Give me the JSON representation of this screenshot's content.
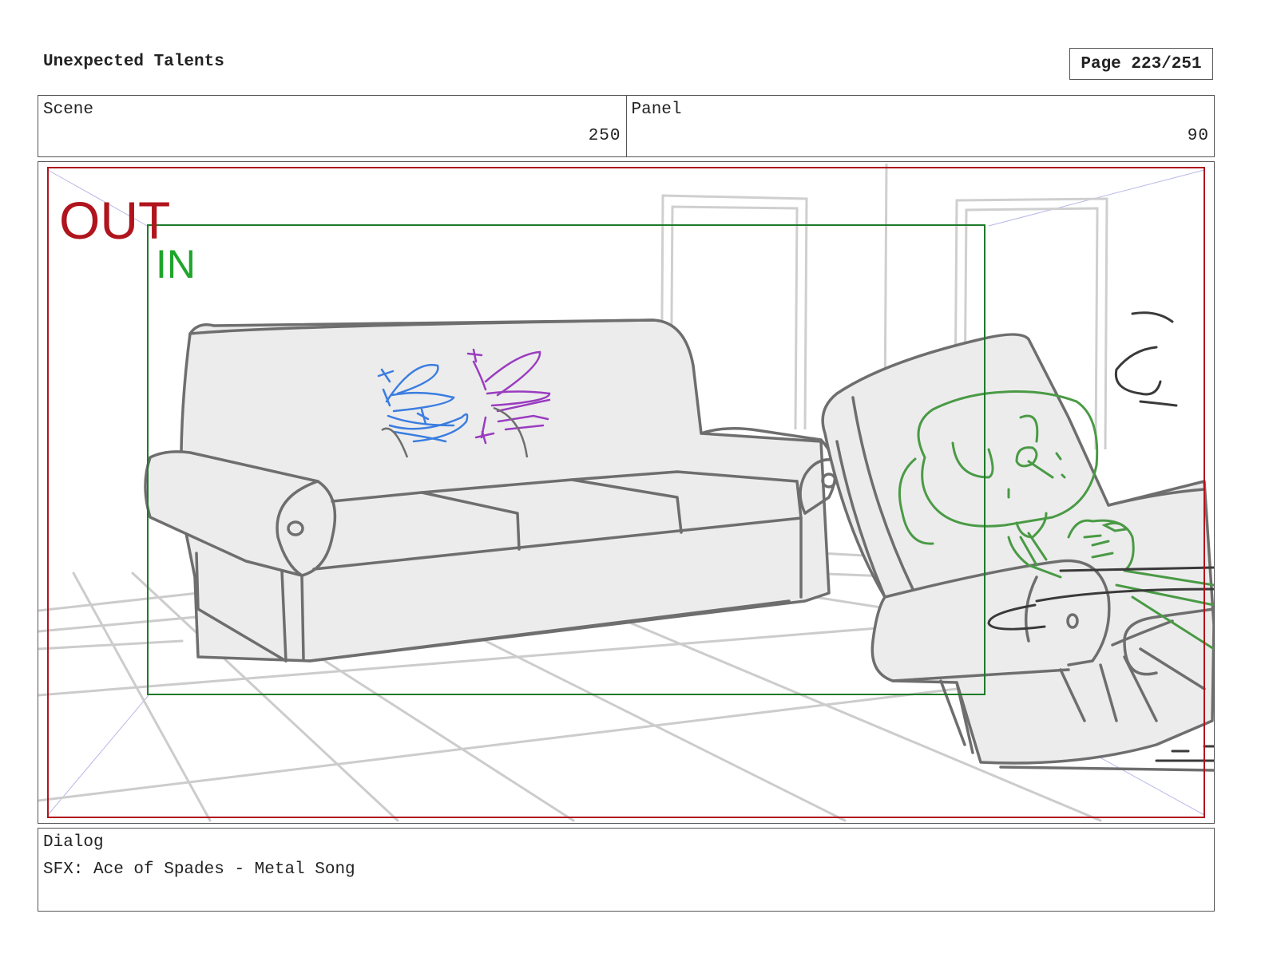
{
  "header": {
    "title": "Unexpected Talents",
    "page": "Page 223/251"
  },
  "info": {
    "scene_label": "Scene",
    "scene_value": "250",
    "panel_label": "Panel",
    "panel_value": "90"
  },
  "panel": {
    "out_label": "OUT",
    "in_label": "IN",
    "colors": {
      "out_frame": "#b0141c",
      "in_frame": "#1e7a2a",
      "pencil": "#777777",
      "fairy_blue": "#3b7de0",
      "fairy_purple": "#9a3cc0",
      "character_green": "#4a9a45"
    }
  },
  "dialog": {
    "label": "Dialog",
    "text": "SFX: Ace of Spades - Metal Song"
  }
}
